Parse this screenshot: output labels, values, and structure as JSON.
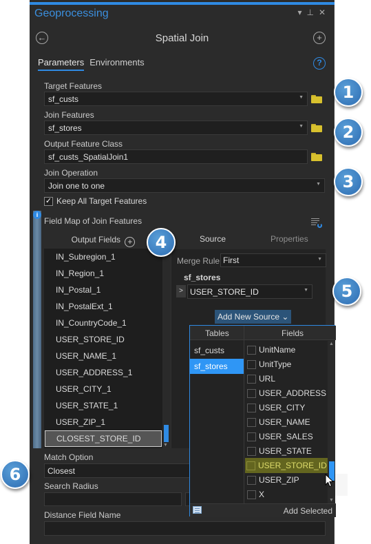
{
  "pane": {
    "title": "Geoprocessing",
    "controls": {
      "menu": "▾",
      "pin": "⊥",
      "close": "✕"
    }
  },
  "tool": {
    "title": "Spatial Join",
    "back_icon": "←",
    "add_icon": "+"
  },
  "tabs": [
    {
      "label": "Parameters",
      "active": true
    },
    {
      "label": "Environments",
      "active": false
    }
  ],
  "help_icon": "?",
  "parameters": {
    "target_features": {
      "label": "Target Features",
      "value": "sf_custs"
    },
    "join_features": {
      "label": "Join Features",
      "value": "sf_stores"
    },
    "output_feature_class": {
      "label": "Output Feature Class",
      "value": "sf_custs_SpatialJoin1"
    },
    "join_operation": {
      "label": "Join Operation",
      "value": "Join one to one"
    },
    "keep_all_target_features": {
      "label": "Keep All Target Features",
      "checked": true
    },
    "match_option": {
      "label": "Match Option",
      "value": "Closest"
    },
    "search_radius": {
      "label": "Search Radius",
      "value": ""
    },
    "distance_field_name": {
      "label": "Distance Field Name",
      "value": ""
    }
  },
  "field_map": {
    "title": "Field Map of Join Features",
    "info_icon": "i",
    "output_fields_header": "Output Fields",
    "output_fields": [
      "IN_Subregion_1",
      "IN_Region_1",
      "IN_Postal_1",
      "IN_PostalExt_1",
      "IN_CountryCode_1",
      "USER_STORE_ID",
      "USER_NAME_1",
      "USER_ADDRESS_1",
      "USER_CITY_1",
      "USER_STATE_1",
      "USER_ZIP_1",
      "CLOSEST_STORE_ID"
    ],
    "selected_output_field": "CLOSEST_STORE_ID",
    "source_tabs": [
      {
        "label": "Source",
        "active": true
      },
      {
        "label": "Properties",
        "active": false
      }
    ],
    "merge_rule": {
      "label": "Merge Rule",
      "value": "First"
    },
    "source_layer": "sf_stores",
    "source_field": "USER_STORE_ID",
    "expander_icon": ">",
    "add_new_source_label": "Add New Source ⌄"
  },
  "add_source_popup": {
    "tables_header": "Tables",
    "fields_header": "Fields",
    "tables": [
      "sf_custs",
      "sf_stores"
    ],
    "selected_table": "sf_stores",
    "fields": [
      {
        "name": "UnitName",
        "checked": false
      },
      {
        "name": "UnitType",
        "checked": false
      },
      {
        "name": "URL",
        "checked": false
      },
      {
        "name": "USER_ADDRESS",
        "checked": false
      },
      {
        "name": "USER_CITY",
        "checked": false
      },
      {
        "name": "USER_NAME",
        "checked": false
      },
      {
        "name": "USER_SALES",
        "checked": false
      },
      {
        "name": "USER_STATE",
        "checked": false
      },
      {
        "name": "USER_STORE_ID",
        "checked": false,
        "hovered": true
      },
      {
        "name": "USER_ZIP",
        "checked": false
      },
      {
        "name": "X",
        "checked": false
      }
    ],
    "add_selected_label": "Add Selected"
  },
  "callouts": [
    "1",
    "2",
    "3",
    "4",
    "5",
    "6"
  ],
  "colors": {
    "accent": "#2f8ae3",
    "panel_bg": "#2b2b2b",
    "selection_blue": "#2f96f5",
    "hover_olive": "#63651f",
    "folder_yellow": "#d8c12e",
    "callout_blue": "#3a7bbd"
  }
}
